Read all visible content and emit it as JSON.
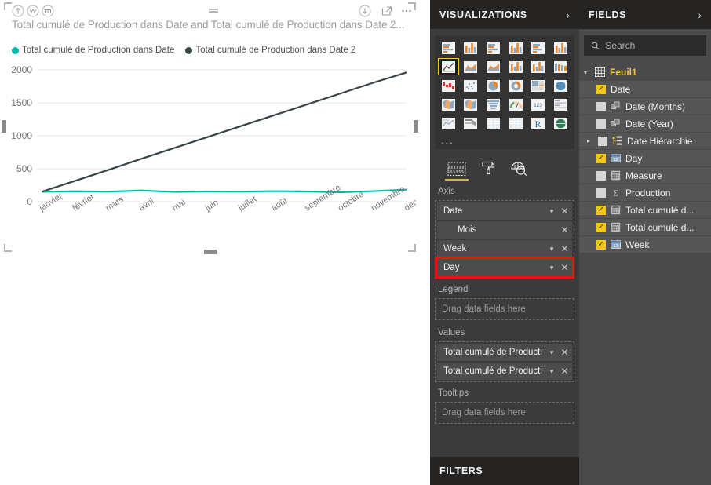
{
  "visual": {
    "title": "Total cumulé de Production dans Date and Total cumulé de Production dans Date 2...",
    "header_icons": [
      {
        "name": "drill-up-icon",
        "label": "Drill Up"
      },
      {
        "name": "drill-down-icon",
        "label": "Drill Down"
      },
      {
        "name": "expand-hierarchy-icon",
        "label": "Expand all down one level in the hierarchy"
      },
      {
        "name": "drill-mode-icon",
        "label": "Drill Mode"
      },
      {
        "name": "download-icon",
        "label": "Export data"
      },
      {
        "name": "focus-mode-icon",
        "label": "Focus mode"
      },
      {
        "name": "more-options-icon",
        "label": "More options"
      }
    ]
  },
  "chart_data": {
    "type": "line",
    "title": "Total cumulé de Production dans Date and Total cumulé de Production dans Date 2...",
    "xlabel": "",
    "ylabel": "",
    "ylim": [
      0,
      2000
    ],
    "yticks": [
      0,
      500,
      1000,
      1500,
      2000
    ],
    "grid": true,
    "legend_position": "top",
    "categories": [
      "janvier",
      "février",
      "mars",
      "avril",
      "mai",
      "juin",
      "juillet",
      "août",
      "septembre",
      "octobre",
      "novembre",
      "décembre"
    ],
    "series": [
      {
        "name": "Total cumulé de Production dans Date",
        "color": "#01B8AA",
        "values": [
          150,
          158,
          152,
          170,
          148,
          155,
          152,
          160,
          155,
          142,
          160,
          182
        ]
      },
      {
        "name": "Total cumulé de Production dans Date 2",
        "color": "#374649",
        "values": [
          150,
          315,
          480,
          650,
          815,
          980,
          1145,
          1310,
          1475,
          1640,
          1805,
          1960
        ]
      }
    ]
  },
  "visualizations": {
    "title": "VISUALIZATIONS",
    "collapse_icon": "chevron-right-icon",
    "more_visuals_label": "...",
    "gallery": [
      {
        "name": "stacked-bar-chart",
        "selected": false
      },
      {
        "name": "stacked-column-chart",
        "selected": false
      },
      {
        "name": "clustered-bar-chart",
        "selected": false
      },
      {
        "name": "clustered-column-chart",
        "selected": false
      },
      {
        "name": "100-percent-stacked-bar-chart",
        "selected": false
      },
      {
        "name": "100-percent-stacked-column-chart",
        "selected": false
      },
      {
        "name": "line-chart",
        "selected": true
      },
      {
        "name": "area-chart",
        "selected": false
      },
      {
        "name": "stacked-area-chart",
        "selected": false
      },
      {
        "name": "line-and-stacked-column-chart",
        "selected": false
      },
      {
        "name": "line-and-clustered-column-chart",
        "selected": false
      },
      {
        "name": "ribbon-chart",
        "selected": false
      },
      {
        "name": "waterfall-chart",
        "selected": false
      },
      {
        "name": "scatter-chart",
        "selected": false
      },
      {
        "name": "pie-chart",
        "selected": false
      },
      {
        "name": "donut-chart",
        "selected": false
      },
      {
        "name": "treemap",
        "selected": false
      },
      {
        "name": "map",
        "selected": false
      },
      {
        "name": "filled-map",
        "selected": false
      },
      {
        "name": "shape-map",
        "selected": false
      },
      {
        "name": "funnel-chart",
        "selected": false
      },
      {
        "name": "gauge-chart",
        "selected": false
      },
      {
        "name": "card",
        "selected": false
      },
      {
        "name": "multi-row-card",
        "selected": false
      },
      {
        "name": "kpi",
        "selected": false
      },
      {
        "name": "slicer",
        "selected": false
      },
      {
        "name": "table",
        "selected": false
      },
      {
        "name": "matrix",
        "selected": false
      },
      {
        "name": "r-script-visual",
        "selected": false
      },
      {
        "name": "arcgis-map",
        "selected": false
      }
    ],
    "tabs": [
      {
        "name": "fields-tab",
        "icon": "fields-grid-icon",
        "active": true
      },
      {
        "name": "format-tab",
        "icon": "paint-roller-icon",
        "active": false
      },
      {
        "name": "analytics-tab",
        "icon": "magnifier-chart-icon",
        "active": false
      }
    ],
    "wells": [
      {
        "name": "axis",
        "label": "Axis",
        "pills": [
          {
            "name": "Date",
            "sub": false,
            "caret": true,
            "highlighted": false
          },
          {
            "name": "Mois",
            "sub": true,
            "caret": false,
            "highlighted": false
          },
          {
            "name": "Week",
            "sub": false,
            "caret": true,
            "highlighted": false
          },
          {
            "name": "Day",
            "sub": false,
            "caret": true,
            "highlighted": true
          }
        ]
      },
      {
        "name": "legend",
        "label": "Legend",
        "placeholder": "Drag data fields here",
        "pills": []
      },
      {
        "name": "values",
        "label": "Values",
        "pills": [
          {
            "name": "Total cumulé de Producti",
            "sub": false,
            "caret": true,
            "highlighted": false
          },
          {
            "name": "Total cumulé de Producti",
            "sub": false,
            "caret": true,
            "highlighted": false
          }
        ]
      },
      {
        "name": "tooltips",
        "label": "Tooltips",
        "placeholder": "Drag data fields here",
        "pills": []
      }
    ],
    "highlight_color": "#ee1111"
  },
  "filters": {
    "title": "FILTERS"
  },
  "fields": {
    "title": "FIELDS",
    "collapse_icon": "chevron-right-icon",
    "search": {
      "placeholder": "Search",
      "value": "",
      "icon": "search-icon"
    },
    "table": {
      "name": "Feuil1",
      "expanded": true,
      "icon": "table-icon"
    },
    "items": [
      {
        "label": "Date",
        "checked": true,
        "icon": "none",
        "expandable": false
      },
      {
        "label": "Date (Months)",
        "checked": false,
        "icon": "group-icon",
        "expandable": false
      },
      {
        "label": "Date (Year)",
        "checked": false,
        "icon": "group-icon",
        "expandable": false
      },
      {
        "label": "Date Hiérarchie",
        "checked": false,
        "icon": "hierarchy-icon",
        "expandable": true
      },
      {
        "label": "Day",
        "checked": true,
        "icon": "date-icon",
        "expandable": false
      },
      {
        "label": "Measure",
        "checked": false,
        "icon": "measure-icon",
        "expandable": false
      },
      {
        "label": "Production",
        "checked": false,
        "icon": "sigma-icon",
        "expandable": false
      },
      {
        "label": "Total cumulé d...",
        "checked": true,
        "icon": "measure-icon",
        "expandable": false
      },
      {
        "label": "Total cumulé d...",
        "checked": true,
        "icon": "measure-icon",
        "expandable": false
      },
      {
        "label": "Week",
        "checked": true,
        "icon": "date-icon",
        "expandable": false
      }
    ],
    "annotation_marker": {
      "name": "red-square-marker",
      "color": "#ee1111"
    }
  }
}
